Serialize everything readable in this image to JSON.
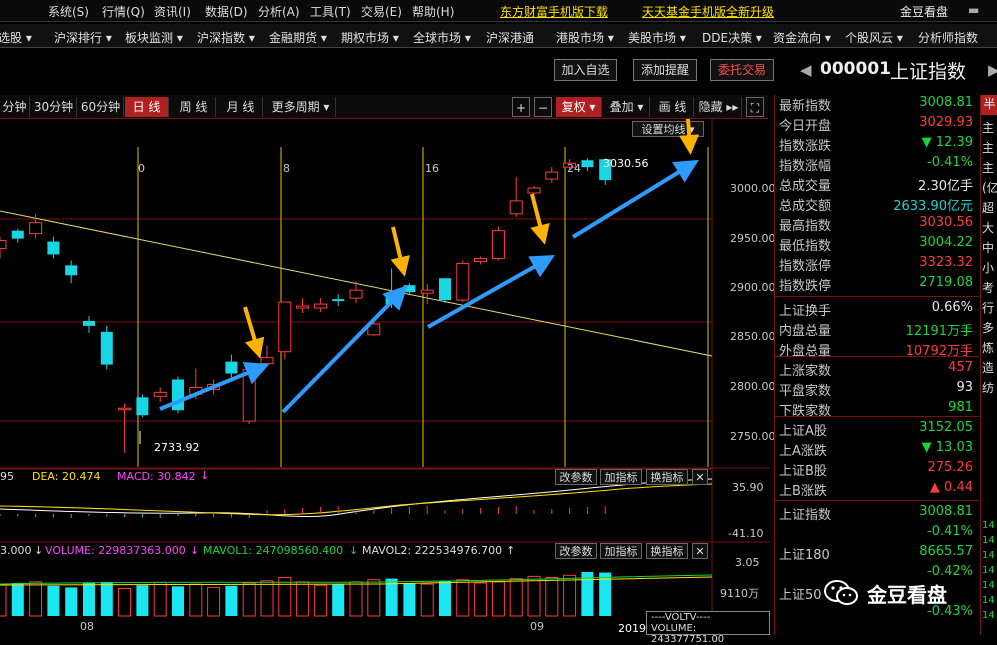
{
  "menu": {
    "items": [
      "系统(S)",
      "行情(Q)",
      "资讯(I)",
      "数据(D)",
      "分析(A)",
      "工具(T)",
      "交易(E)",
      "帮助(H)"
    ],
    "promo1": "东方财富手机版下载",
    "promo2": "天天基金手机版全新升级",
    "brand": "金豆看盘"
  },
  "nav": {
    "items": [
      "选股 ▾",
      "沪深排行 ▾",
      "板块监测 ▾",
      "沪深指数 ▾",
      "金融期货 ▾",
      "期权市场 ▾",
      "全球市场 ▾",
      "沪深港通",
      "港股市场 ▾",
      "美股市场 ▾",
      "DDE决策 ▾",
      "资金流向 ▾",
      "个股风云 ▾",
      "分析师指数"
    ]
  },
  "actions": {
    "add_watch": "加入自选",
    "add_alert": "添加提醒",
    "trade": "委托交易",
    "code": "000001",
    "name": "上证指数"
  },
  "periods": {
    "items": [
      "分钟",
      "30分钟",
      "60分钟",
      "日 线",
      "周 线",
      "月 线",
      "更多周期 ▾"
    ],
    "active": "日 线"
  },
  "toolbar": {
    "plus": "+",
    "minus": "−",
    "fuquan": "复权 ▾",
    "overlay": "叠加 ▾",
    "draw": "画 线",
    "hide": "隐藏 ▸▸",
    "ma_setting": "设置均线 ▾"
  },
  "chart_data": {
    "type": "candlestick",
    "y_ticks": [
      "3000.00",
      "2950.00",
      "2900.00",
      "2850.00",
      "2800.00",
      "2750.00"
    ],
    "day_markers": [
      "0",
      "8",
      "16",
      "24"
    ],
    "x_labels": [
      "08",
      "09",
      "2019"
    ],
    "high_label": "3030.56",
    "low_label": "2733.92",
    "candles": [
      {
        "o": 2940,
        "c": 2948,
        "h": 2952,
        "l": 2930
      },
      {
        "o": 2958,
        "c": 2950,
        "h": 2960,
        "l": 2946
      },
      {
        "o": 2955,
        "c": 2966,
        "h": 2975,
        "l": 2950
      },
      {
        "o": 2947,
        "c": 2934,
        "h": 2952,
        "l": 2930
      },
      {
        "o": 2923,
        "c": 2913,
        "h": 2928,
        "l": 2905
      },
      {
        "o": 2867,
        "c": 2862,
        "h": 2872,
        "l": 2855
      },
      {
        "o": 2856,
        "c": 2823,
        "h": 2862,
        "l": 2818
      },
      {
        "o": 2778,
        "c": 2779,
        "h": 2784,
        "l": 2734
      },
      {
        "o": 2790,
        "c": 2772,
        "h": 2793,
        "l": 2770
      },
      {
        "o": 2791,
        "c": 2795,
        "h": 2800,
        "l": 2785
      },
      {
        "o": 2808,
        "c": 2777,
        "h": 2811,
        "l": 2774
      },
      {
        "o": 2793,
        "c": 2800,
        "h": 2819,
        "l": 2788
      },
      {
        "o": 2798,
        "c": 2803,
        "h": 2808,
        "l": 2793
      },
      {
        "o": 2826,
        "c": 2814,
        "h": 2833,
        "l": 2810
      },
      {
        "o": 2766,
        "c": 2818,
        "h": 2820,
        "l": 2763
      },
      {
        "o": 2824,
        "c": 2830,
        "h": 2842,
        "l": 2822
      },
      {
        "o": 2836,
        "c": 2886,
        "h": 2886,
        "l": 2828
      },
      {
        "o": 2880,
        "c": 2882,
        "h": 2890,
        "l": 2875
      },
      {
        "o": 2880,
        "c": 2884,
        "h": 2890,
        "l": 2876
      },
      {
        "o": 2889,
        "c": 2887,
        "h": 2894,
        "l": 2882
      },
      {
        "o": 2890,
        "c": 2898,
        "h": 2907,
        "l": 2885
      },
      {
        "o": 2853,
        "c": 2864,
        "h": 2868,
        "l": 2852
      },
      {
        "o": 2892,
        "c": 2884,
        "h": 2920,
        "l": 2880
      },
      {
        "o": 2903,
        "c": 2896,
        "h": 2905,
        "l": 2893
      },
      {
        "o": 2895,
        "c": 2898,
        "h": 2904,
        "l": 2884
      },
      {
        "o": 2910,
        "c": 2888,
        "h": 2910,
        "l": 2885
      },
      {
        "o": 2888,
        "c": 2925,
        "h": 2928,
        "l": 2886
      },
      {
        "o": 2927,
        "c": 2930,
        "h": 2932,
        "l": 2924
      },
      {
        "o": 2930,
        "c": 2958,
        "h": 2962,
        "l": 2928
      },
      {
        "o": 2975,
        "c": 2988,
        "h": 3012,
        "l": 2972
      },
      {
        "o": 2996,
        "c": 3001,
        "h": 3003,
        "l": 2995
      },
      {
        "o": 3010,
        "c": 3017,
        "h": 3022,
        "l": 3006
      },
      {
        "o": 3022,
        "c": 3026,
        "h": 3030,
        "l": 3020
      },
      {
        "o": 3029,
        "c": 3022,
        "h": 3031,
        "l": 3018
      },
      {
        "o": 3030,
        "c": 3009,
        "h": 3031,
        "l": 3004
      }
    ],
    "volumes": [
      58,
      60,
      62,
      55,
      52,
      60,
      62,
      50,
      56,
      61,
      54,
      58,
      52,
      55,
      60,
      64,
      70,
      62,
      56,
      58,
      62,
      66,
      68,
      60,
      58,
      64,
      66,
      60,
      62,
      68,
      72,
      70,
      74,
      80,
      79
    ]
  },
  "macd": {
    "prefix": "95",
    "dea": "DEA: 20.474",
    "macd": "MACD: 30.842",
    "arrow": "↓",
    "btn_params": "改参数",
    "btn_add": "加指标",
    "btn_switch": "换指标",
    "top": "35.90",
    "bottom": "-41.10"
  },
  "volume_ind": {
    "prefix": "3.000",
    "volume": "VOLUME: 229837363.000",
    "mavol1": "MAVOL1: 247098560.400",
    "mavol2": "MAVOL2: 222534976.700",
    "top": "3.05",
    "unit": "9110万",
    "voltv": "----VOLTV----",
    "voltv_val": "VOLUME: 243377751.00"
  },
  "quote": {
    "rows": [
      {
        "label": "最新指数",
        "value": "3008.81",
        "cls": "dn"
      },
      {
        "label": "今日开盘",
        "value": "3029.93",
        "cls": "up"
      },
      {
        "label": "指数涨跌",
        "value": "▼ 12.39",
        "cls": "dn"
      },
      {
        "label": "指数涨幅",
        "value": "-0.41%",
        "cls": "dn"
      },
      {
        "label": "总成交量",
        "value": "2.30亿手",
        "cls": "wt"
      },
      {
        "label": "总成交额",
        "value": "2633.90亿元",
        "cls": "cy"
      },
      {
        "label": "最高指数",
        "value": "3030.56",
        "cls": "up"
      },
      {
        "label": "最低指数",
        "value": "3004.22",
        "cls": "dn"
      },
      {
        "label": "指数涨停",
        "value": "3323.32",
        "cls": "up"
      },
      {
        "label": "指数跌停",
        "value": "2719.08",
        "cls": "dn"
      }
    ],
    "rows2": [
      {
        "label": "上证换手",
        "value": "0.66%",
        "cls": "wt"
      },
      {
        "label": "内盘总量",
        "value": "12191万手",
        "cls": "dn"
      },
      {
        "label": "外盘总量",
        "value": "10792万手",
        "cls": "up"
      }
    ],
    "rows3": [
      {
        "label": "上涨家数",
        "value": "457",
        "cls": "up"
      },
      {
        "label": "平盘家数",
        "value": "93",
        "cls": "wt"
      },
      {
        "label": "下跌家数",
        "value": "981",
        "cls": "dn"
      }
    ],
    "rows4": [
      {
        "label": "上证A股",
        "value": "3152.05",
        "cls": "dn"
      },
      {
        "label": "上A涨跌",
        "value": "▼ 13.03",
        "cls": "dn"
      },
      {
        "label": "上证B股",
        "value": "275.26",
        "cls": "up"
      },
      {
        "label": "上B涨跌",
        "value": "▲ 0.44",
        "cls": "up"
      }
    ],
    "rows5": [
      {
        "label": "上证指数",
        "value": "3008.81",
        "cls": "dn"
      },
      {
        "label": "",
        "value": "-0.41%",
        "cls": "dn"
      },
      {
        "label": "上证180",
        "value": "8665.57",
        "cls": "dn"
      },
      {
        "label": "",
        "value": "-0.42%",
        "cls": "dn"
      },
      {
        "label": "上证50",
        "value": "",
        "cls": "dn"
      },
      {
        "label": "",
        "value": "-0.43%",
        "cls": "dn"
      }
    ],
    "watermark": "金豆看盘"
  },
  "side_right": {
    "chars": [
      "主",
      "主",
      "主",
      "(亿",
      "超",
      "大",
      "中",
      "小",
      "考",
      "行",
      "多",
      "炼",
      "造",
      "纺"
    ],
    "nums": [
      "14",
      "14",
      "14",
      "14",
      "14",
      "14",
      "14"
    ]
  }
}
